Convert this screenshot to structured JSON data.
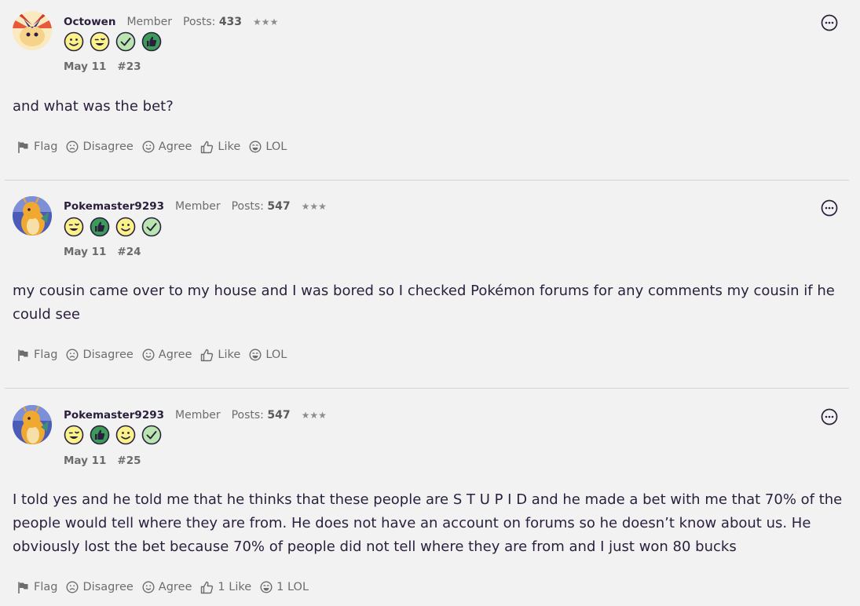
{
  "posts": [
    {
      "username": "Octowen",
      "role": "Member",
      "posts_label": "Posts:",
      "post_count": "433",
      "stars": "★★★",
      "badges": [
        "smile-icon",
        "wink-icon",
        "check-icon",
        "thumbs-up-icon"
      ],
      "date": "May 11",
      "number": "#23",
      "content": "and what was the bet?",
      "actions": {
        "flag": "Flag",
        "disagree": "Disagree",
        "agree": "Agree",
        "like": "Like",
        "lol": "LOL"
      }
    },
    {
      "username": "Pokemaster9293",
      "role": "Member",
      "posts_label": "Posts:",
      "post_count": "547",
      "stars": "★★★",
      "badges": [
        "wink-icon",
        "thumbs-up-icon",
        "smile-icon",
        "check-icon"
      ],
      "date": "May 11",
      "number": "#24",
      "content": "my cousin came over to my house and I was bored so I checked Pokémon forums for any comments my cousin if he could see",
      "actions": {
        "flag": "Flag",
        "disagree": "Disagree",
        "agree": "Agree",
        "like": "Like",
        "lol": "LOL"
      }
    },
    {
      "username": "Pokemaster9293",
      "role": "Member",
      "posts_label": "Posts:",
      "post_count": "547",
      "stars": "★★★",
      "badges": [
        "wink-icon",
        "thumbs-up-icon",
        "smile-icon",
        "check-icon"
      ],
      "date": "May 11",
      "number": "#25",
      "content": "I told yes and he told me that he thinks that these people are S T U P I D and he made a bet with me that 70% of the people would tell where they are from. He does not have an account on forums so he doesn’t know about us. He obviously lost the bet because 70% of people did not tell where they are from and I just won 80 bucks",
      "actions": {
        "flag": "Flag",
        "disagree": "Disagree",
        "agree": "Agree",
        "like": "1 Like",
        "lol": "1 LOL"
      }
    }
  ],
  "colors": {
    "background": "#f2f2f2",
    "text": "#2a1f3d",
    "muted": "#6d6d6d",
    "badge_yellow": "#fbf38a",
    "badge_green_light": "#b9e6b0",
    "badge_green_dark": "#3c9a5a"
  }
}
